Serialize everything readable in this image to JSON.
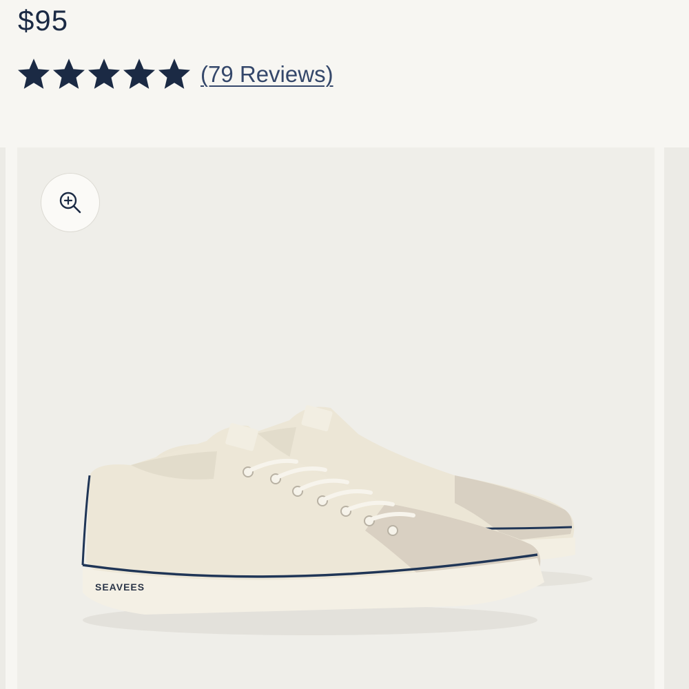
{
  "product": {
    "price": "$95",
    "rating": 5,
    "rating_max": 5,
    "reviews_label": "(79 Reviews)",
    "brand_logo_text": "SEAVEES"
  },
  "gallery": {
    "zoom_icon": "zoom-in-icon",
    "image_alt": "Cream canvas low-top sneakers with suede toe caps and navy stripe"
  },
  "colors": {
    "star": "#1b2a44",
    "text": "#1b2a44",
    "link": "#34476a",
    "background": "#f7f6f2",
    "image_background": "#efeee9"
  }
}
